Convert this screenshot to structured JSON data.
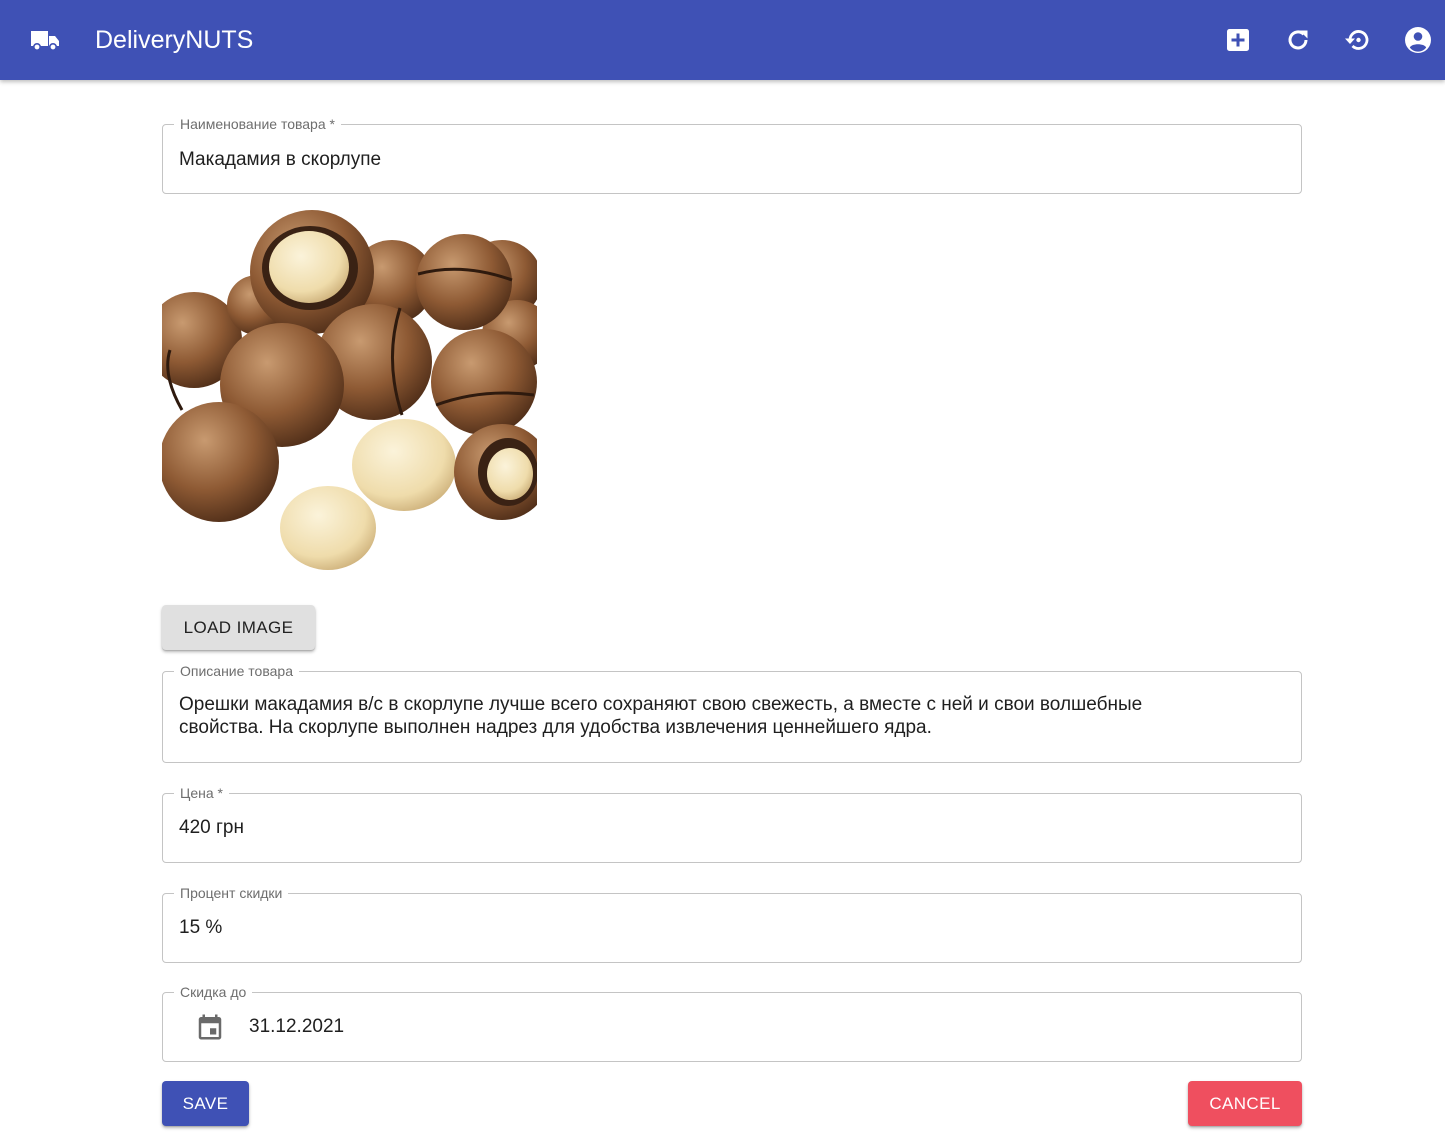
{
  "appbar": {
    "title": "DeliveryNUTS",
    "brand_color": "#3f51b5",
    "icons": [
      "truck-icon",
      "add-box-icon",
      "refresh-icon",
      "restore-icon",
      "account-circle-icon"
    ]
  },
  "form": {
    "name": {
      "label": "Наименование товара",
      "required_mark": " *",
      "value": "Макадамия в скорлупе"
    },
    "image": {
      "alt": "Макадамия в скорлупе"
    },
    "load_image_label": "LOAD IMAGE",
    "description": {
      "label": "Описание товара",
      "line1": "Орешки макадамия в/с в скорлупе лучше всего сохраняют свою свежесть, а вместе с ней и свои волшебные",
      "line2": "свойства. На скорлупе выполнен надрез для удобства извлечения ценнейшего ядра."
    },
    "price": {
      "label": "Цена",
      "required_mark": " *",
      "value": "420 грн"
    },
    "discount_percent": {
      "label": "Процент скидки",
      "value": "15 %"
    },
    "discount_until": {
      "label": "Скидка до",
      "value": "31.12.2021"
    }
  },
  "actions": {
    "save_label": "SAVE",
    "cancel_label": "CANCEL",
    "cancel_color": "#ef4f5f"
  }
}
